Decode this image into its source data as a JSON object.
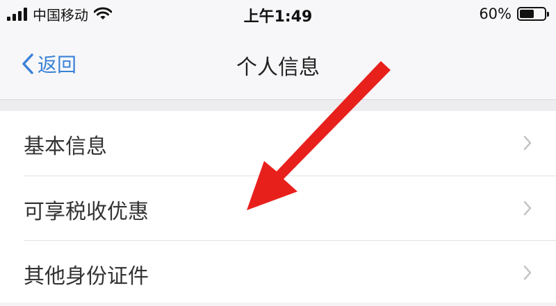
{
  "status_bar": {
    "carrier": "中国移动",
    "time": "上午1:49",
    "battery_percent": "60%",
    "battery_level": 0.6
  },
  "nav": {
    "back_label": "返回",
    "title": "个人信息"
  },
  "list": {
    "items": [
      {
        "label": "基本信息"
      },
      {
        "label": "可享税收优惠"
      },
      {
        "label": "其他身份证件"
      }
    ]
  },
  "colors": {
    "accent": "#3a82d6",
    "annotation_arrow": "#e8201c"
  }
}
